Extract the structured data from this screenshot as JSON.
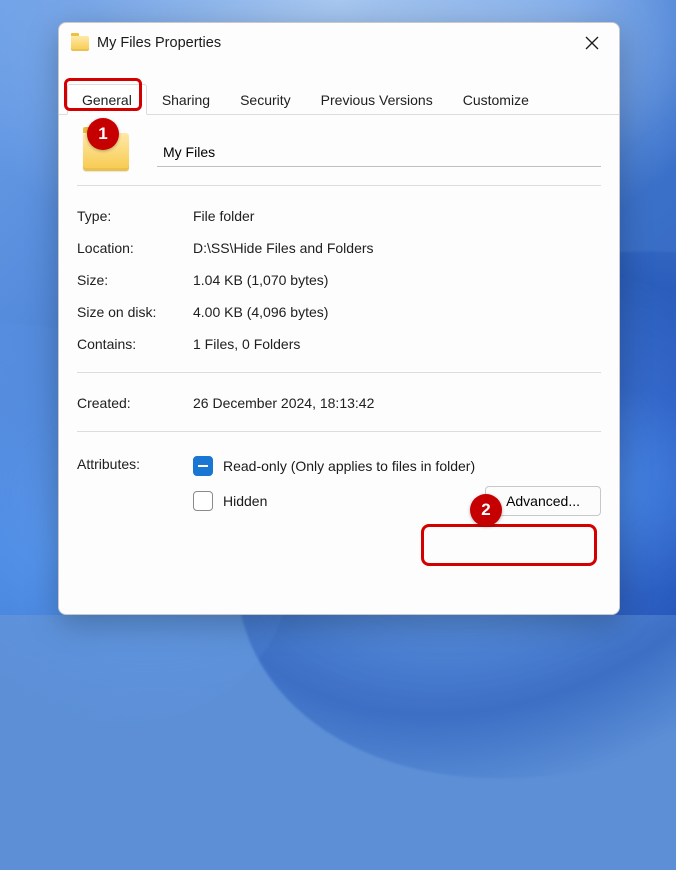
{
  "titlebar": {
    "title": "My Files Properties"
  },
  "tabs": [
    {
      "label": "General",
      "active": true
    },
    {
      "label": "Sharing",
      "active": false
    },
    {
      "label": "Security",
      "active": false
    },
    {
      "label": "Previous Versions",
      "active": false
    },
    {
      "label": "Customize",
      "active": false
    }
  ],
  "folder_name": "My Files",
  "info": {
    "type_label": "Type:",
    "type_value": "File folder",
    "location_label": "Location:",
    "location_value": "D:\\SS\\Hide Files and Folders",
    "size_label": "Size:",
    "size_value": "1.04 KB (1,070 bytes)",
    "size_on_disk_label": "Size on disk:",
    "size_on_disk_value": "4.00 KB (4,096 bytes)",
    "contains_label": "Contains:",
    "contains_value": "1 Files, 0 Folders",
    "created_label": "Created:",
    "created_value": "26 December 2024, 18:13:42"
  },
  "attributes": {
    "label": "Attributes:",
    "readonly_label": "Read-only (Only applies to files in folder)",
    "hidden_label": "Hidden",
    "advanced_label": "Advanced..."
  },
  "annotations": {
    "badge1": "1",
    "badge2": "2"
  }
}
